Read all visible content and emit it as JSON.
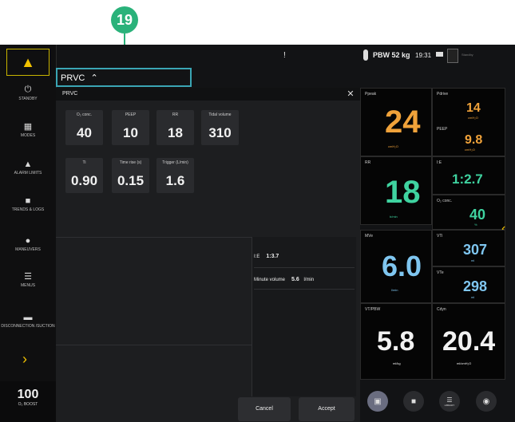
{
  "callout": {
    "number": "19"
  },
  "topbar": {
    "alert": "!",
    "patient": "PBW 52 kg",
    "time": "19:31",
    "status_text": "Standby"
  },
  "sidebar": {
    "items": [
      {
        "label": "STANDBY"
      },
      {
        "label": "MODES"
      },
      {
        "label": "ALARM LIMITS"
      },
      {
        "label": "TRENDS & LOGS"
      },
      {
        "label": "MANEUVERS"
      },
      {
        "label": "MENUS"
      },
      {
        "label": "DISCONNECTION /SUCTION"
      }
    ],
    "boost_value": "100",
    "boost_label": "O₂ BOOST"
  },
  "mode": {
    "name": "PRVC",
    "dialog_title": "PRVC"
  },
  "settings": [
    {
      "label": "O₂ conc.",
      "value": "40"
    },
    {
      "label": "PEEP",
      "value": "10"
    },
    {
      "label": "RR",
      "value": "18"
    },
    {
      "label": "Tidal volume",
      "value": "310"
    },
    {
      "label": "Ti",
      "value": "0.90"
    },
    {
      "label": "Time rise (s)",
      "value": "0.15"
    },
    {
      "label": "Trigger (L/min)",
      "value": "1.6"
    }
  ],
  "info": {
    "ie_label": "I:E",
    "ie_value": "1:3.7",
    "mv_label": "Minute volume",
    "mv_value": "5.6",
    "mv_unit": "l/min"
  },
  "buttons": {
    "cancel": "Cancel",
    "accept": "Accept"
  },
  "panels": {
    "ppeak": {
      "label": "Ppeak",
      "value": "24",
      "unit": "cmH₂O"
    },
    "pdrive": {
      "label": "Pdrive",
      "value": "14",
      "unit": "cmH₂O"
    },
    "peep": {
      "label": "PEEP",
      "value": "9.8",
      "unit": "cmH₂O"
    },
    "rr": {
      "label": "RR",
      "value": "18",
      "unit": "b/min"
    },
    "ie": {
      "label": "I:E",
      "value": "1:2.7"
    },
    "o2": {
      "label": "O₂ conc.",
      "value": "40",
      "unit": "%"
    },
    "mve": {
      "label": "MVe",
      "value": "6.0",
      "unit": "l/min"
    },
    "vti": {
      "label": "VTi",
      "value": "307",
      "unit": "ml"
    },
    "vte": {
      "label": "VTe",
      "value": "298",
      "unit": "ml"
    },
    "vtpbw": {
      "label": "VT/PBW",
      "value": "5.8",
      "unit": "ml/kg"
    },
    "cdyn": {
      "label": "Cdyn",
      "value": "20.4",
      "unit": "ml/cmH₂O"
    }
  },
  "bottom": {
    "library_label": "LIBRARY"
  },
  "colors": {
    "accent_orange": "#f0a23a",
    "accent_green": "#3fd3a0",
    "accent_blue": "#7fc6f0",
    "callout": "#2ab27a",
    "highlight_box": "#3aa5b4"
  }
}
